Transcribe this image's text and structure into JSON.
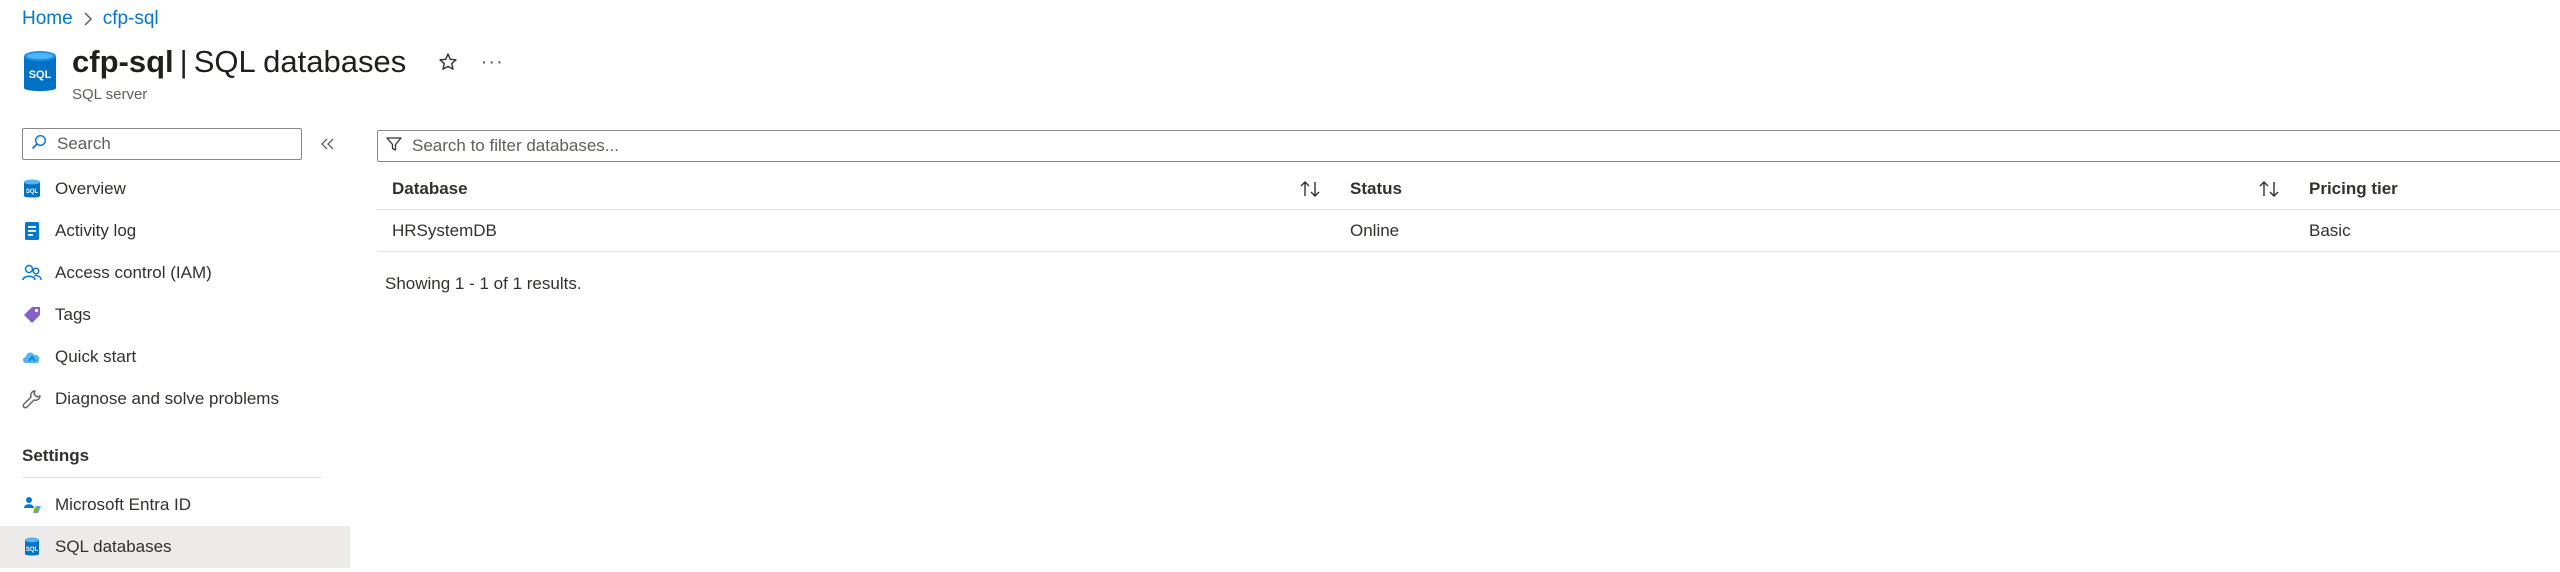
{
  "breadcrumb": {
    "home": "Home",
    "current": "cfp-sql"
  },
  "header": {
    "resource_name": "cfp-sql",
    "divider": "|",
    "blade_title": "SQL databases",
    "subtitle": "SQL server",
    "more": "···"
  },
  "sidebar": {
    "search_placeholder": "Search",
    "items": [
      {
        "label": "Overview",
        "icon": "sql-server-icon"
      },
      {
        "label": "Activity log",
        "icon": "activity-log-icon"
      },
      {
        "label": "Access control (IAM)",
        "icon": "people-icon"
      },
      {
        "label": "Tags",
        "icon": "tag-icon"
      },
      {
        "label": "Quick start",
        "icon": "cloud-quickstart-icon"
      },
      {
        "label": "Diagnose and solve problems",
        "icon": "wrench-icon"
      }
    ],
    "settings_header": "Settings",
    "settings_items": [
      {
        "label": "Microsoft Entra ID",
        "icon": "entra-id-icon"
      },
      {
        "label": "SQL databases",
        "icon": "sql-database-icon",
        "selected": true
      }
    ]
  },
  "main": {
    "filter_placeholder": "Search to filter databases...",
    "columns": [
      "Database",
      "Status",
      "Pricing tier"
    ],
    "rows": [
      {
        "database": "HRSystemDB",
        "status": "Online",
        "pricing_tier": "Basic"
      }
    ],
    "results_text": "Showing 1 - 1 of 1 results."
  },
  "colors": {
    "accent": "#0078d4",
    "selected_bg": "#edebe9",
    "border": "#e1dfdd"
  }
}
